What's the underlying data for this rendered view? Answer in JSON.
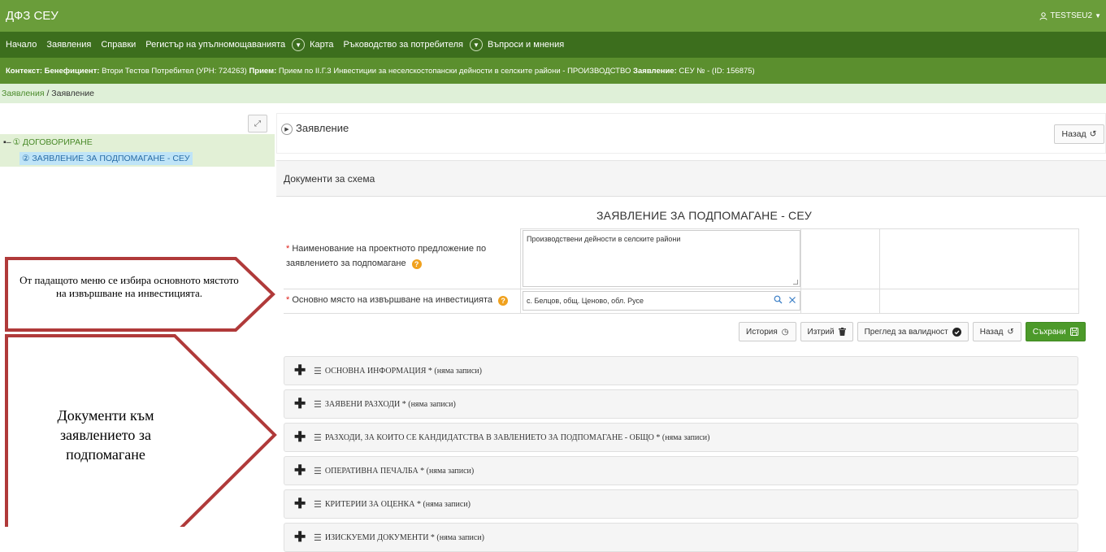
{
  "topbar": {
    "brand": "ДФЗ СЕУ",
    "user": "TESTSEU2"
  },
  "nav": {
    "items": [
      "Начало",
      "Заявления",
      "Справки",
      "Регистър на упълномощаванията",
      "Карта",
      "Ръководство за потребителя",
      "Въпроси и мнения"
    ]
  },
  "context": {
    "label_context": "Контекст:",
    "label_beneficiary": "Бенефициент:",
    "beneficiary": "Втори Тестов Потребител (УРН: 724263)",
    "label_intake": "Прием:",
    "intake": "Прием по II.Г.3 Инвестиции за неселскостопански дейности в селските райони - ПРОИЗВОДСТВО",
    "label_application": "Заявление:",
    "application": "СЕУ № - (ID: 156875)"
  },
  "breadcrumb": {
    "link": "Заявления",
    "separator": "/",
    "current": "Заявление"
  },
  "tree": {
    "item1": "① ДОГОВОРИРАНЕ",
    "item2": "② ЗАЯВЛЕНИЕ ЗА ПОДПОМАГАНЕ - СЕУ"
  },
  "card": {
    "title": "Заявление",
    "back": "Назад"
  },
  "docs": {
    "title": "Документи за схема"
  },
  "form": {
    "title": "ЗАЯВЛЕНИЕ ЗА ПОДПОМАГАНЕ - СЕУ",
    "field1_label_a": "Наименование на проектното предложение по",
    "field1_label_b": "заявлението за подпомагане",
    "field1_value": "Производствени дейности в селските райони",
    "field2_label": "Основно място на извършване на инвестицията",
    "field2_value": "с. Белцов, общ. Ценово, обл. Русе",
    "required_mark": "*",
    "help_mark": "?"
  },
  "buttons": {
    "history": "История",
    "delete": "Изтрий",
    "validity": "Преглед за валидност",
    "back": "Назад",
    "save": "Съхрани"
  },
  "sections": [
    "ОСНОВНА ИНФОРМАЦИЯ * (няма записи)",
    "ЗАЯВЕНИ РАЗХОДИ * (няма записи)",
    "РАЗХОДИ, ЗА КОИТО СЕ КАНДИДАТСТВА В ЗАВЛЕНИЕТО ЗА ПОДПОМАГАНЕ - ОБЩО * (няма записи)",
    "ОПЕРАТИВНА ПЕЧАЛБА * (няма записи)",
    "КРИТЕРИИ ЗА ОЦЕНКА * (няма записи)",
    "ИЗИСКУЕМИ ДОКУМЕНТИ * (няма записи)"
  ],
  "callouts": {
    "top": "От падащото меню се избира основното мястото на извършване на инвестицията.",
    "bottom": "Документи към заявлението за подпомагане"
  },
  "icons": {
    "user": "user-icon",
    "chevron": "chevron-down-icon",
    "expand": "expand-icon",
    "play": "play-icon",
    "undo": "undo-icon",
    "search": "search-icon",
    "clear": "close-icon",
    "history": "history-icon",
    "trash": "trash-icon",
    "check": "check-circle-icon",
    "save": "floppy-disk-icon",
    "plus": "plus-icon",
    "list": "list-icon"
  },
  "colors": {
    "topbar": "#6a9d3a",
    "navbar": "#3c6e1d",
    "context": "#5b8f2e",
    "breadcrumb_bg": "#dff0d8",
    "save_button": "#4c9a2a",
    "callout_border": "#b03a3a",
    "required": "#e0201a",
    "help": "#f0a11e"
  }
}
